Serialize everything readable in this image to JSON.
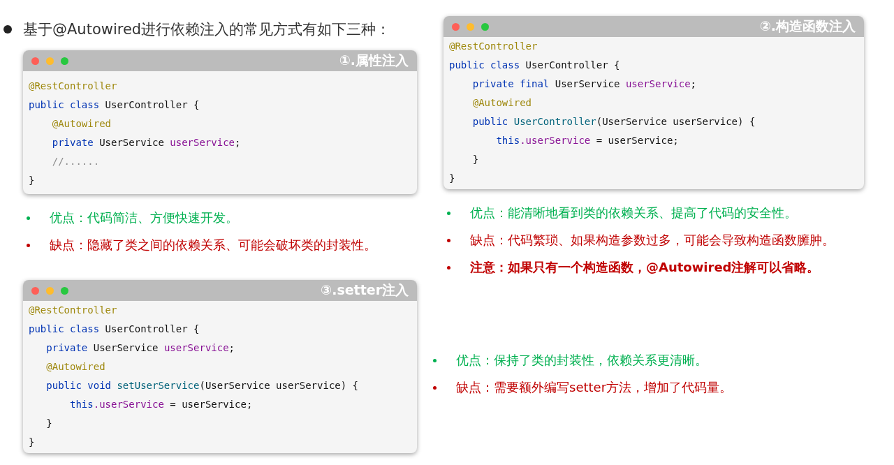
{
  "heading": "基于@Autowired进行依赖注入的常见方式有如下三种：",
  "sections": [
    {
      "title": "①.属性注入",
      "code": [
        [
          {
            "kind": "annotation",
            "text": "@RestController"
          }
        ],
        [
          {
            "kind": "keyword",
            "text": "public class"
          },
          {
            "kind": "plain",
            "text": " UserController {"
          }
        ],
        [
          {
            "kind": "annotation",
            "text": "    @Autowired"
          }
        ],
        [
          {
            "kind": "keyword",
            "text": "    private"
          },
          {
            "kind": "plain",
            "text": " UserService "
          },
          {
            "kind": "field",
            "text": "userService"
          },
          {
            "kind": "plain",
            "text": ";"
          }
        ],
        [
          {
            "kind": "comment",
            "text": "    //......"
          }
        ],
        [
          {
            "kind": "plain",
            "text": "}"
          }
        ]
      ],
      "points": [
        {
          "kind": "pro",
          "text": "优点：代码简洁、方便快速开发。"
        },
        {
          "kind": "con",
          "text": "缺点：隐藏了类之间的依赖关系、可能会破坏类的封装性。"
        }
      ]
    },
    {
      "title": "②.构造函数注入",
      "code": [
        [
          {
            "kind": "annotation",
            "text": "@RestController"
          }
        ],
        [
          {
            "kind": "keyword",
            "text": "public class"
          },
          {
            "kind": "plain",
            "text": " UserController {"
          }
        ],
        [
          {
            "kind": "keyword",
            "text": "    private final"
          },
          {
            "kind": "plain",
            "text": " UserService "
          },
          {
            "kind": "field",
            "text": "userService"
          },
          {
            "kind": "plain",
            "text": ";"
          }
        ],
        [
          {
            "kind": "annotation",
            "text": "    @Autowired"
          }
        ],
        [
          {
            "kind": "keyword",
            "text": "    public "
          },
          {
            "kind": "method",
            "text": "UserController"
          },
          {
            "kind": "plain",
            "text": "(UserService userService) {"
          }
        ],
        [
          {
            "kind": "keyword",
            "text": "        this"
          },
          {
            "kind": "field",
            "text": ".userService"
          },
          {
            "kind": "plain",
            "text": " = userService;"
          }
        ],
        [
          {
            "kind": "plain",
            "text": "    }"
          }
        ],
        [
          {
            "kind": "plain",
            "text": "}"
          }
        ]
      ],
      "points": [
        {
          "kind": "pro",
          "text": "优点：能清晰地看到类的依赖关系、提高了代码的安全性。"
        },
        {
          "kind": "con",
          "text": "缺点：代码繁琐、如果构造参数过多，可能会导致构造函数臃肿。"
        },
        {
          "kind": "note",
          "text": "注意：如果只有一个构造函数，@Autowired注解可以省略。"
        }
      ]
    },
    {
      "title": "③.setter注入",
      "code": [
        [
          {
            "kind": "annotation",
            "text": "@RestController"
          }
        ],
        [
          {
            "kind": "keyword",
            "text": "public class"
          },
          {
            "kind": "plain",
            "text": " UserController {"
          }
        ],
        [
          {
            "kind": "keyword",
            "text": "   private"
          },
          {
            "kind": "plain",
            "text": " UserService "
          },
          {
            "kind": "field",
            "text": "userService"
          },
          {
            "kind": "plain",
            "text": ";"
          }
        ],
        [
          {
            "kind": "annotation",
            "text": "   @Autowired"
          }
        ],
        [
          {
            "kind": "keyword",
            "text": "   public void "
          },
          {
            "kind": "method",
            "text": "setUserService"
          },
          {
            "kind": "plain",
            "text": "(UserService userService) {"
          }
        ],
        [
          {
            "kind": "keyword",
            "text": "       this"
          },
          {
            "kind": "field",
            "text": ".userService"
          },
          {
            "kind": "plain",
            "text": " = userService;"
          }
        ],
        [
          {
            "kind": "plain",
            "text": "   }"
          }
        ],
        [
          {
            "kind": "plain",
            "text": "}"
          }
        ]
      ],
      "points": [
        {
          "kind": "pro",
          "text": "优点：保持了类的封装性，依赖关系更清晰。"
        },
        {
          "kind": "con",
          "text": "缺点：需要额外编写setter方法，增加了代码量。"
        }
      ]
    }
  ]
}
